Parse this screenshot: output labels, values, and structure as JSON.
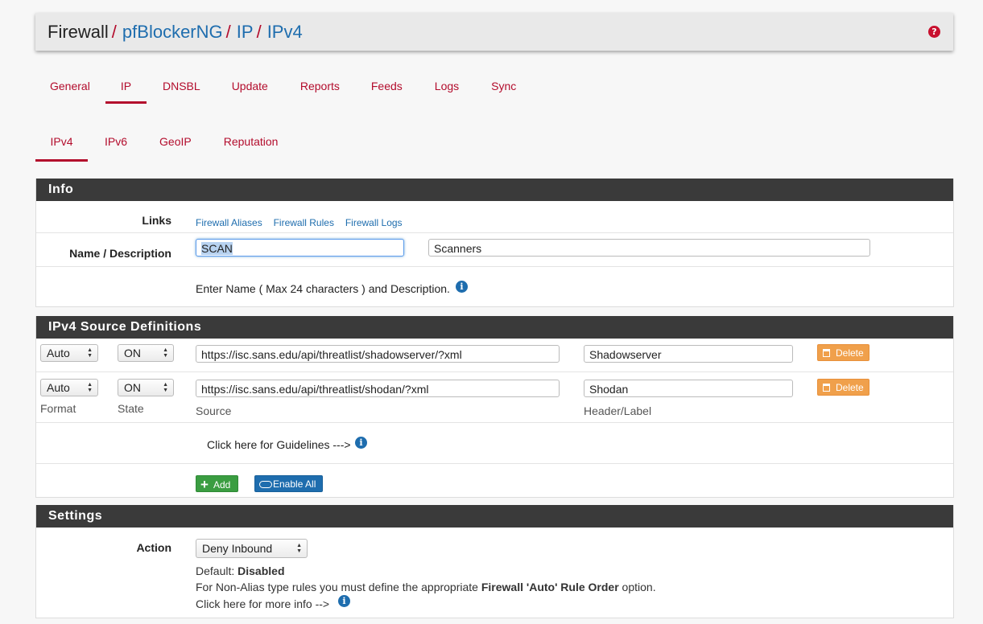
{
  "breadcrumb": {
    "root": "Firewall",
    "sep": "/",
    "items": [
      "pfBlockerNG",
      "IP",
      "IPv4"
    ],
    "help_icon": "question-circle-icon"
  },
  "main_tabs": [
    {
      "label": "General",
      "active": false
    },
    {
      "label": "IP",
      "active": true
    },
    {
      "label": "DNSBL",
      "active": false
    },
    {
      "label": "Update",
      "active": false
    },
    {
      "label": "Reports",
      "active": false
    },
    {
      "label": "Feeds",
      "active": false
    },
    {
      "label": "Logs",
      "active": false
    },
    {
      "label": "Sync",
      "active": false
    }
  ],
  "sub_tabs": [
    {
      "label": "IPv4",
      "active": true
    },
    {
      "label": "IPv6",
      "active": false
    },
    {
      "label": "GeoIP",
      "active": false
    },
    {
      "label": "Reputation",
      "active": false
    }
  ],
  "info": {
    "heading": "Info",
    "links_label": "Links",
    "links": [
      "Firewall Aliases",
      "Firewall Rules",
      "Firewall Logs"
    ],
    "name_desc_label": "Name / Description",
    "name_value": "SCAN",
    "description_value": "Scanners",
    "help_text": "Enter Name ( Max 24 characters ) and Description."
  },
  "source_defs": {
    "heading": "IPv4 Source Definitions",
    "rows": [
      {
        "format": "Auto",
        "state": "ON",
        "source": "https://isc.sans.edu/api/threatlist/shadowserver/?xml",
        "header": "Shadowserver",
        "delete_label": "Delete"
      },
      {
        "format": "Auto",
        "state": "ON",
        "source": "https://isc.sans.edu/api/threatlist/shodan/?xml",
        "header": "Shodan",
        "delete_label": "Delete"
      }
    ],
    "col_labels": {
      "format": "Format",
      "state": "State",
      "source": "Source",
      "header": "Header/Label"
    },
    "guidelines_text": "Click here for Guidelines --->",
    "add_label": "Add",
    "enable_all_label": "Enable All"
  },
  "settings": {
    "heading": "Settings",
    "action_label": "Action",
    "action_value": "Deny Inbound",
    "default_prefix": "Default: ",
    "default_value": "Disabled",
    "note_prefix": "For Non-Alias type rules you must define the appropriate ",
    "note_bold": "Firewall 'Auto' Rule Order",
    "note_suffix": " option.",
    "more_info_text": "Click here for more info -->"
  },
  "colors": {
    "accent": "#b30c2c",
    "link": "#1e6dae",
    "header_bg": "#3a3a3a",
    "warning": "#f0a04b",
    "success": "#3a9d41"
  }
}
